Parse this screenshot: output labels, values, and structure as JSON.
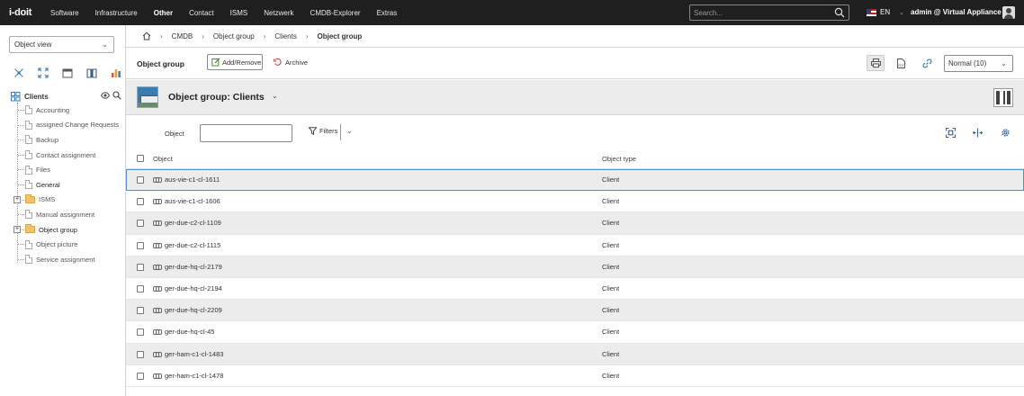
{
  "topbar": {
    "logo": "i-doit",
    "nav": [
      "Software",
      "Infrastructure",
      "Other",
      "Contact",
      "ISMS",
      "Netzwerk",
      "CMDB-Explorer",
      "Extras"
    ],
    "active_nav": "Other",
    "search_placeholder": "Search...",
    "language": "EN",
    "user": "admin @ Virtual Appliance"
  },
  "sidebar": {
    "view_select": "Object view",
    "tree_root": "Clients",
    "tree_items": [
      {
        "label": "Accounting",
        "icon": "doc"
      },
      {
        "label": "assigned Change Requests",
        "icon": "doc"
      },
      {
        "label": "Backup",
        "icon": "doc"
      },
      {
        "label": "Contact assignment",
        "icon": "doc"
      },
      {
        "label": "Files",
        "icon": "doc"
      },
      {
        "label": "General",
        "icon": "doc"
      },
      {
        "label": "ISMS",
        "icon": "folder"
      },
      {
        "label": "Manual assignment",
        "icon": "doc"
      },
      {
        "label": "Object group",
        "icon": "folder"
      },
      {
        "label": "Object picture",
        "icon": "doc"
      },
      {
        "label": "Service assignment",
        "icon": "doc"
      }
    ]
  },
  "breadcrumb": [
    "CMDB",
    "Object group",
    "Clients",
    "Object group"
  ],
  "actionbar": {
    "title": "Object group",
    "add_remove_label": "Add/Remove",
    "archive_label": "Archive",
    "page_size": "Normal (10)"
  },
  "object_header": {
    "title": "Object group: Clients"
  },
  "filter": {
    "object_label": "Object",
    "object_value": "",
    "filters_label": "Filters"
  },
  "table": {
    "columns": [
      "Object",
      "Object type"
    ],
    "rows": [
      {
        "object": "aus-vie-c1-cl-1611",
        "type": "Client"
      },
      {
        "object": "aus-vie-c1-cl-1606",
        "type": "Client"
      },
      {
        "object": "ger-due-c2-cl-1109",
        "type": "Client"
      },
      {
        "object": "ger-due-c2-cl-1115",
        "type": "Client"
      },
      {
        "object": "ger-due-hq-cl-2179",
        "type": "Client"
      },
      {
        "object": "ger-due-hq-cl-2194",
        "type": "Client"
      },
      {
        "object": "ger-due-hq-cl-2209",
        "type": "Client"
      },
      {
        "object": "ger-due-hq-cl-45",
        "type": "Client"
      },
      {
        "object": "ger-ham-c1-cl-1483",
        "type": "Client"
      },
      {
        "object": "ger-ham-c1-cl-1478",
        "type": "Client"
      }
    ]
  }
}
